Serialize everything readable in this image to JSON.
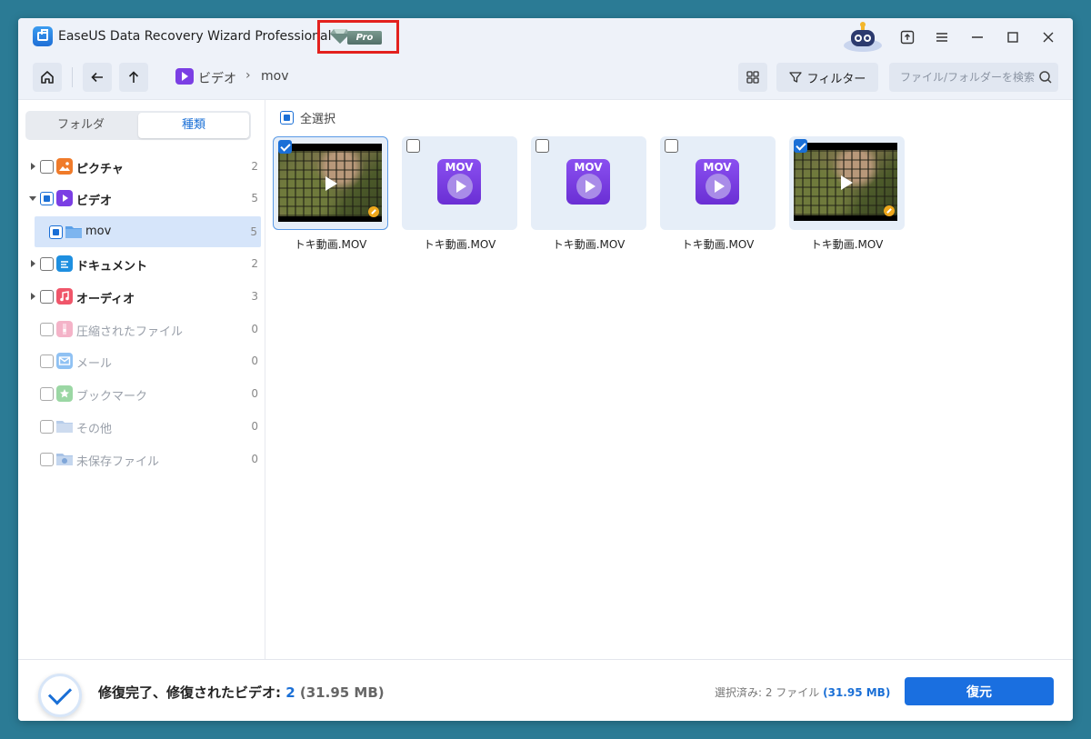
{
  "app": {
    "title": "EaseUS Data Recovery Wizard Professional",
    "pro_tag": "Pro"
  },
  "nav": {
    "breadcrumb": [
      "ビデオ",
      "mov"
    ],
    "filter_label": "フィルター",
    "search_placeholder": "ファイル/フォルダーを検索"
  },
  "sidebar": {
    "tabs": [
      {
        "label": "フォルダ",
        "active": false
      },
      {
        "label": "種類",
        "active": true
      }
    ],
    "categories": [
      {
        "label": "ピクチャ",
        "count": "2",
        "icon": "picture-icon",
        "color": "#f07b2a"
      },
      {
        "label": "ビデオ",
        "count": "5",
        "icon": "video-icon",
        "color": "#7b3fe4"
      },
      {
        "label": "mov",
        "count": "5",
        "icon": "folder-icon",
        "color": "#5ba0e8"
      },
      {
        "label": "ドキュメント",
        "count": "2",
        "icon": "document-icon",
        "color": "#1e8fe0"
      },
      {
        "label": "オーディオ",
        "count": "3",
        "icon": "audio-icon",
        "color": "#f0566a"
      },
      {
        "label": "圧縮されたファイル",
        "count": "0",
        "icon": "archive-icon",
        "color": "#f4b3c8"
      },
      {
        "label": "メール",
        "count": "0",
        "icon": "mail-icon",
        "color": "#8fc1f3"
      },
      {
        "label": "ブックマーク",
        "count": "0",
        "icon": "bookmark-icon",
        "color": "#9bd7a4"
      },
      {
        "label": "その他",
        "count": "0",
        "icon": "other-folder-icon",
        "color": "#b7cdea"
      },
      {
        "label": "未保存ファイル",
        "count": "0",
        "icon": "unsaved-file-icon",
        "color": "#a9c3e6"
      }
    ]
  },
  "main": {
    "select_all_label": "全選択",
    "files": [
      {
        "name": "トキ動画.MOV",
        "checked": true,
        "thumb": "video-frame"
      },
      {
        "name": "トキ動画.MOV",
        "checked": false,
        "thumb": "mov-icon"
      },
      {
        "name": "トキ動画.MOV",
        "checked": false,
        "thumb": "mov-icon"
      },
      {
        "name": "トキ動画.MOV",
        "checked": false,
        "thumb": "mov-icon"
      },
      {
        "name": "トキ動画.MOV",
        "checked": true,
        "thumb": "video-frame"
      }
    ],
    "mov_label": "MOV"
  },
  "footer": {
    "status_prefix": "修復完了、修復されたビデオ: ",
    "status_count": "2",
    "status_size": " (31.95 MB)",
    "selected_prefix": "選択済み: 2 ファイル ",
    "selected_size": "(31.95 MB)",
    "recover_label": "復元"
  },
  "colors": {
    "accent": "#1a6fe0",
    "pro_highlight": "#e3211e",
    "desktop": "#2b7b95"
  }
}
